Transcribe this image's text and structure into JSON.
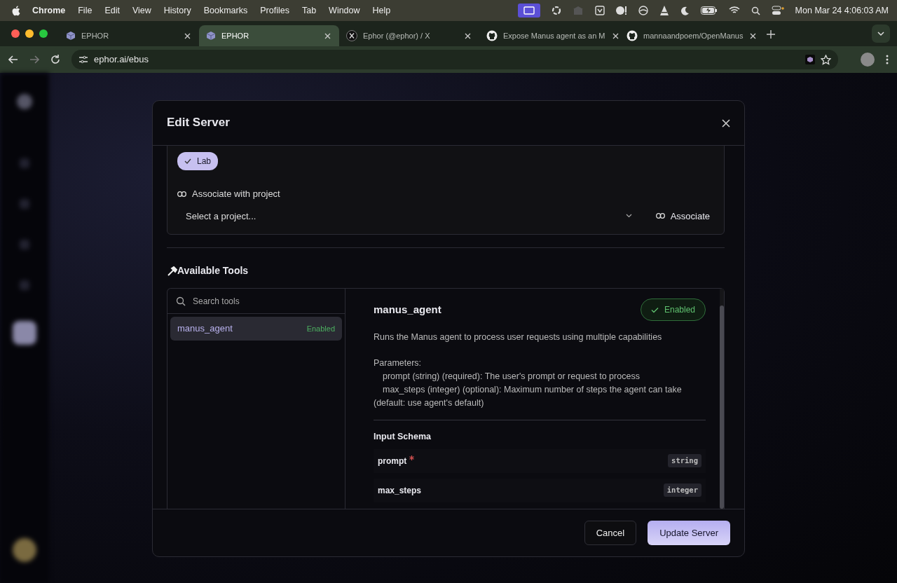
{
  "menubar": {
    "app": "Chrome",
    "menus": [
      "File",
      "Edit",
      "View",
      "History",
      "Bookmarks",
      "Profiles",
      "Tab",
      "Window",
      "Help"
    ],
    "clock": "Mon Mar 24  4:06:03 AM"
  },
  "tabs": [
    {
      "title": "EPHOR",
      "kind": "cube",
      "selected": false
    },
    {
      "title": "EPHOR",
      "kind": "cube",
      "selected": true
    },
    {
      "title": "Ephor (@ephor) / X",
      "kind": "x",
      "selected": false
    },
    {
      "title": "Expose Manus agent as an M",
      "kind": "github",
      "selected": false
    },
    {
      "title": "mannaandpoem/OpenManus",
      "kind": "github",
      "selected": false
    }
  ],
  "address": "ephor.ai/ebus",
  "sidebar": {
    "items": [
      {
        "selected": false
      },
      {
        "selected": false
      },
      {
        "selected": false
      },
      {
        "selected": false
      },
      {
        "selected": true
      }
    ]
  },
  "modal": {
    "title": "Edit Server",
    "tags": [
      {
        "label": "Lab",
        "checked": true
      }
    ],
    "associate": {
      "label": "Associate with project",
      "placeholder": "Select a project...",
      "button": "Associate"
    },
    "tools_heading": "Available Tools",
    "search": {
      "placeholder": "Search tools"
    },
    "tool_list": [
      {
        "name": "manus_agent",
        "status": "Enabled",
        "selected": true
      }
    ],
    "detail": {
      "name": "manus_agent",
      "enabled": true,
      "status_label": "Enabled",
      "description": "Runs the Manus agent to process user requests using multiple capabilities",
      "parameters_heading": "Parameters:",
      "parameters": [
        "prompt (string) (required): The user's prompt or request to process",
        "max_steps (integer) (optional): Maximum number of steps the agent can take (default: use agent's default)"
      ],
      "schema_heading": "Input Schema",
      "fields": [
        {
          "name": "prompt",
          "required": true,
          "type": "string"
        },
        {
          "name": "max_steps",
          "required": false,
          "type": "integer"
        }
      ]
    },
    "buttons": {
      "cancel": "Cancel",
      "submit": "Update Server"
    }
  }
}
